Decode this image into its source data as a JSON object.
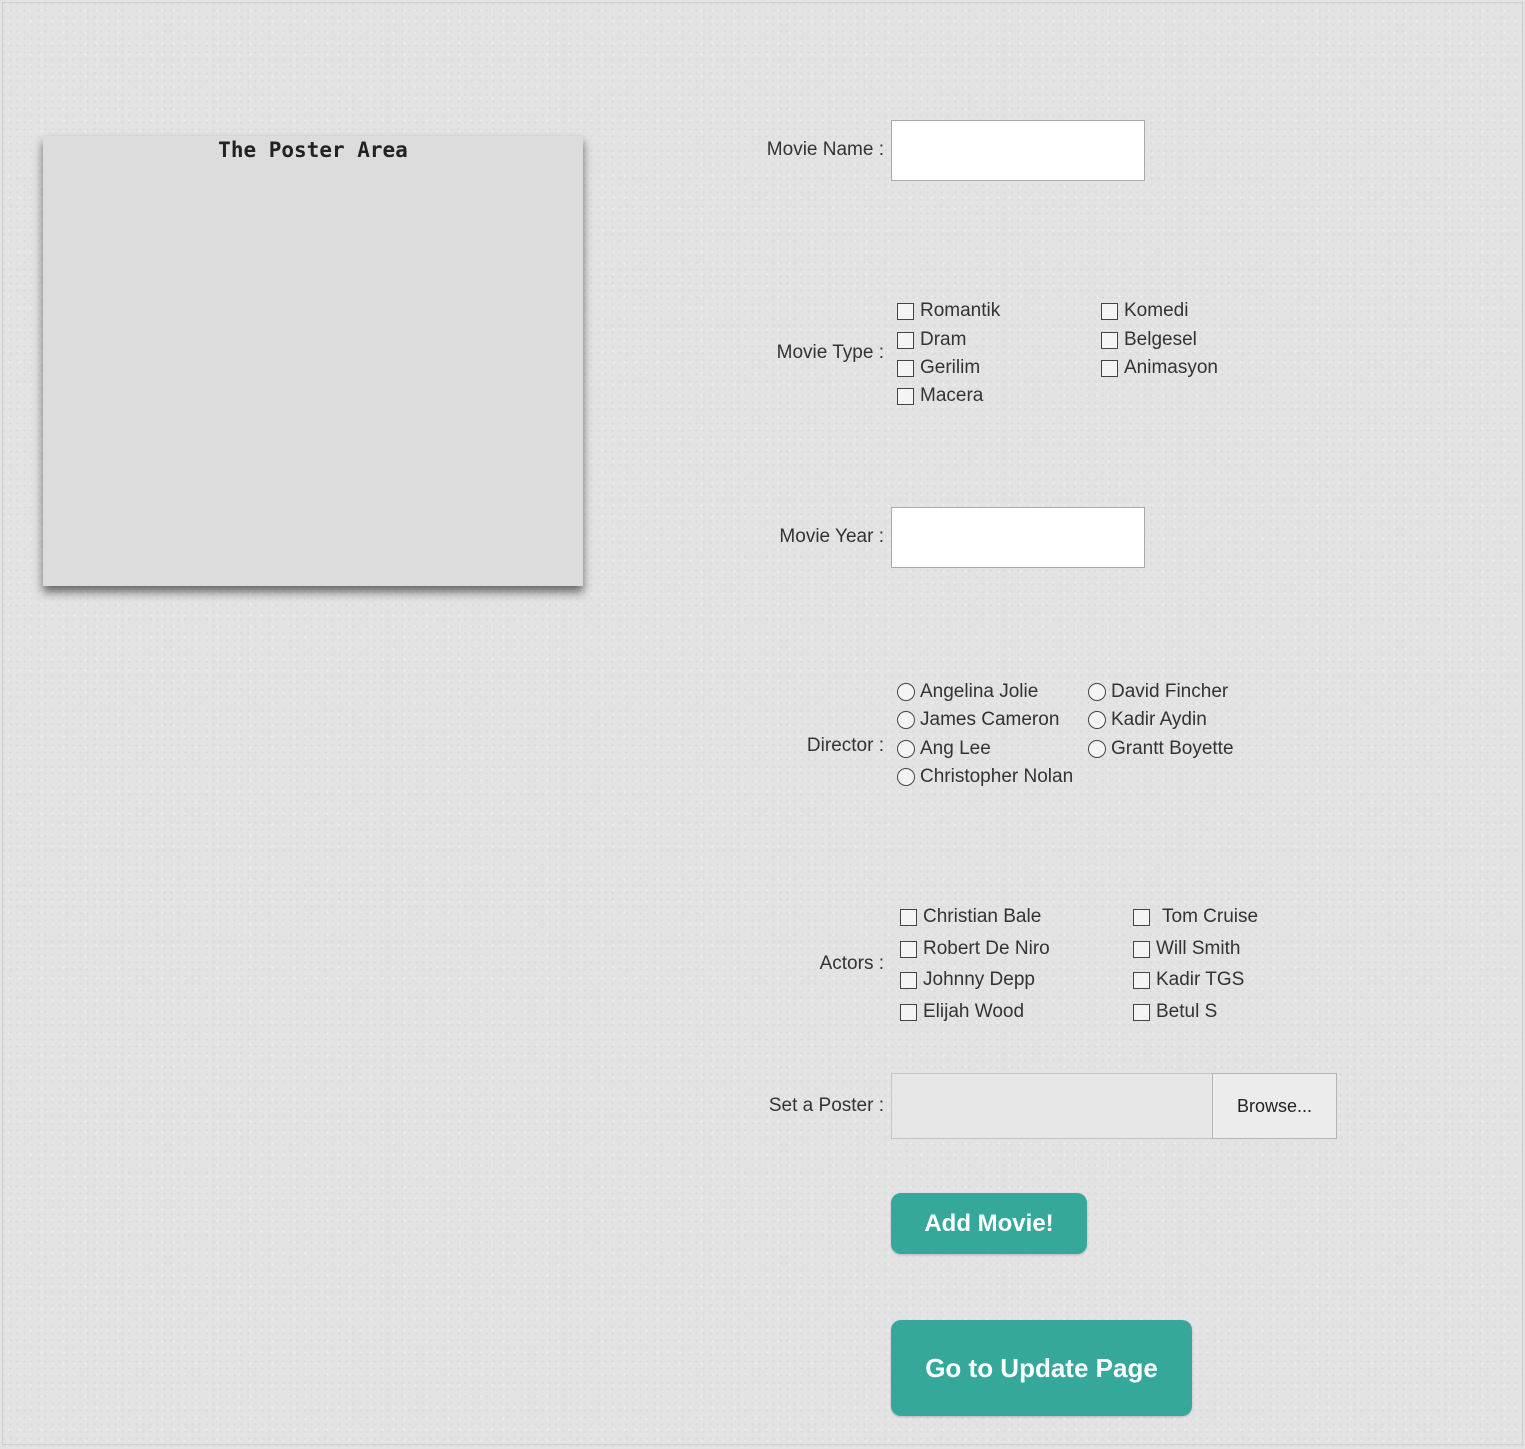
{
  "poster": {
    "title": "The Poster Area"
  },
  "form": {
    "movie_name_label": "Movie Name :",
    "movie_type_label": "Movie Type :",
    "movie_year_label": "Movie Year :",
    "director_label": "Director :",
    "actors_label": "Actors :",
    "poster_label": "Set a Poster :",
    "browse_label": "Browse...",
    "movie_name_value": "",
    "movie_year_value": ""
  },
  "movie_types": [
    "Romantik",
    "Dram",
    "Gerilim",
    "Macera",
    "Komedi",
    "Belgesel",
    "Animasyon"
  ],
  "directors": [
    "Angelina Jolie",
    "James Cameron",
    "Ang Lee",
    "Christopher Nolan",
    "David Fincher",
    "Kadir Aydin",
    "Grantt Boyette"
  ],
  "actors": [
    "Christian Bale",
    "Robert De Niro",
    "Johnny Depp",
    "Elijah Wood",
    "Tom Cruise",
    "Will Smith",
    "Kadir TGS",
    "Betul S"
  ],
  "buttons": {
    "add": "Add Movie!",
    "update": "Go to Update Page"
  }
}
